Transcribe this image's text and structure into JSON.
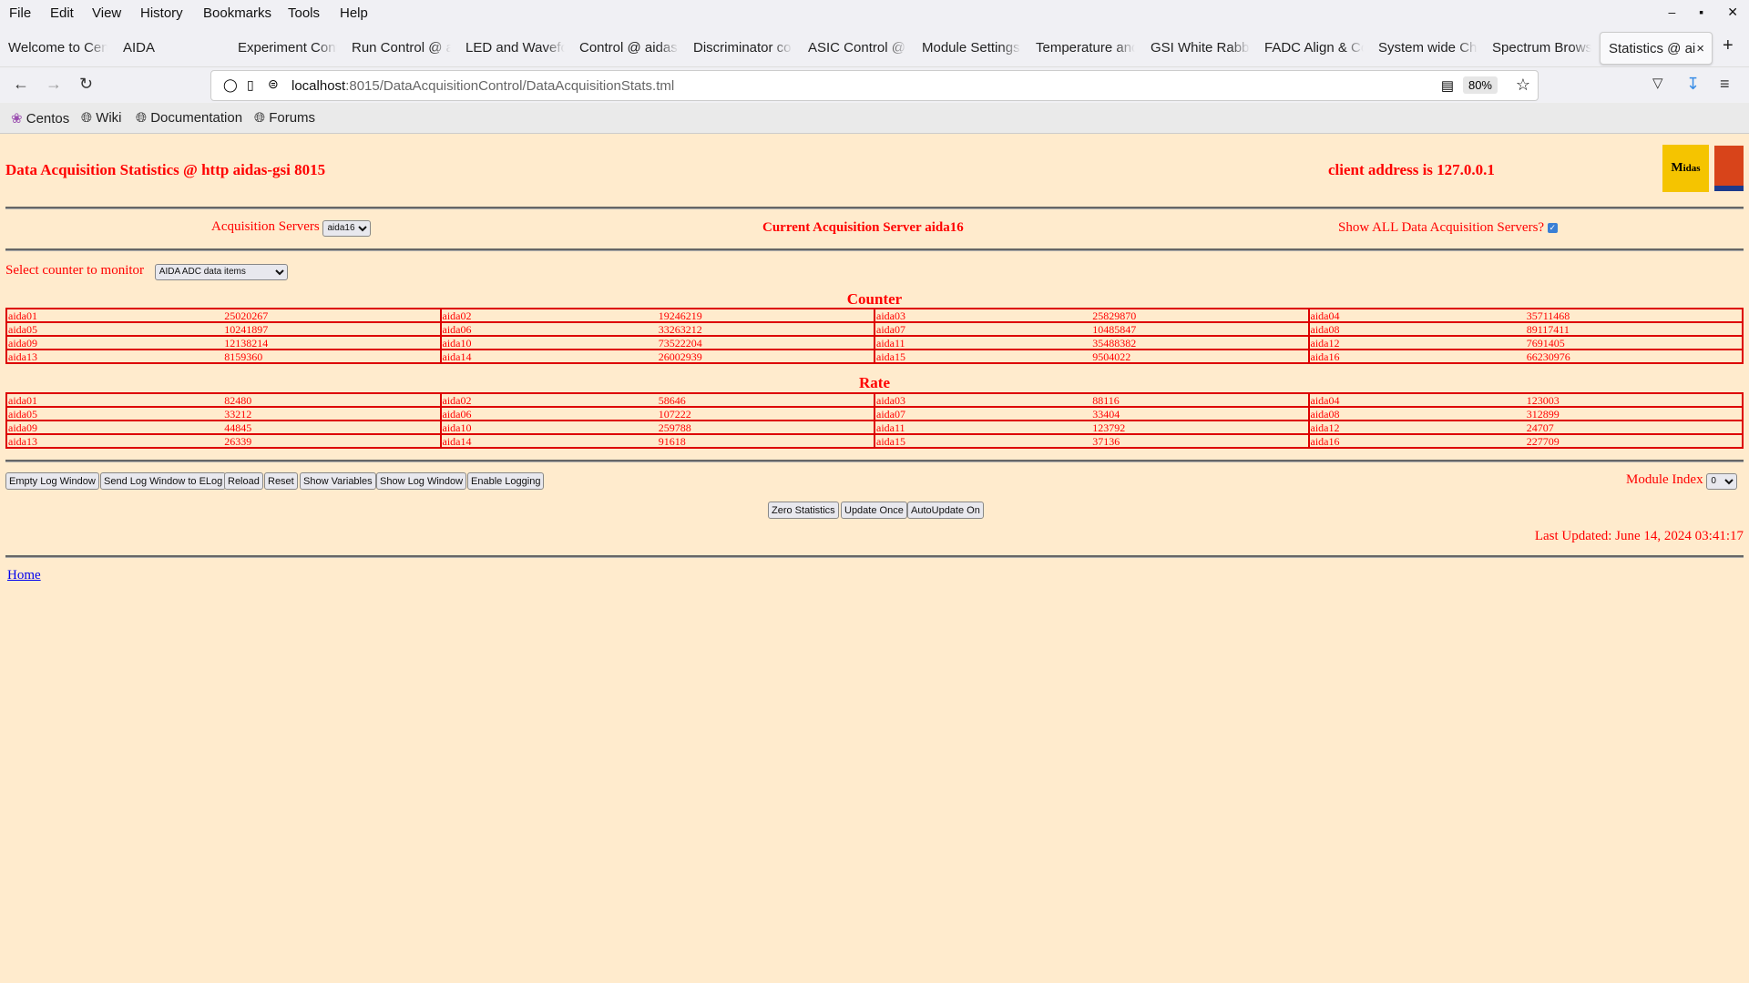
{
  "browser": {
    "menu": [
      "File",
      "Edit",
      "View",
      "History",
      "Bookmarks",
      "Tools",
      "Help"
    ],
    "window_controls": [
      "minimize",
      "maximize",
      "close"
    ],
    "tabs": [
      {
        "label": "Welcome to Cen"
      },
      {
        "label": "AIDA"
      },
      {
        "label": "Experiment Cont"
      },
      {
        "label": "Run Control @ a"
      },
      {
        "label": "LED and Wavefo"
      },
      {
        "label": "Control @ aidas"
      },
      {
        "label": "Discriminator co"
      },
      {
        "label": "ASIC Control @"
      },
      {
        "label": "Module Settings"
      },
      {
        "label": "Temperature and"
      },
      {
        "label": "GSI White Rabbi"
      },
      {
        "label": "FADC Align & Co"
      },
      {
        "label": "System wide Ch"
      },
      {
        "label": "Spectrum Brows"
      },
      {
        "label": "Statistics @ ai",
        "active": true
      }
    ],
    "url_host": "localhost",
    "url_rest": ":8015/DataAcquisitionControl/DataAcquisitionStats.tml",
    "zoom": "80%",
    "bookmarks": [
      "Centos",
      "Wiki",
      "Documentation",
      "Forums"
    ]
  },
  "page": {
    "title": "Data Acquisition Statistics @ http aidas-gsi 8015",
    "client_address": "client address is 127.0.0.1",
    "logo_text": "Midas",
    "acq_servers_label": "Acquisition Servers",
    "acq_servers_value": "aida16",
    "current_server": "Current Acquisition Server aida16",
    "show_all_label": "Show ALL Data Acquisition Servers?",
    "show_all_checked": true,
    "select_counter_label": "Select counter to monitor",
    "select_counter_value": "AIDA ADC data items",
    "counter_heading": "Counter",
    "counter_rows": [
      [
        [
          "aida01",
          "25020267"
        ],
        [
          "aida02",
          "19246219"
        ],
        [
          "aida03",
          "25829870"
        ],
        [
          "aida04",
          "35711468"
        ]
      ],
      [
        [
          "aida05",
          "10241897"
        ],
        [
          "aida06",
          "33263212"
        ],
        [
          "aida07",
          "10485847"
        ],
        [
          "aida08",
          "89117411"
        ]
      ],
      [
        [
          "aida09",
          "12138214"
        ],
        [
          "aida10",
          "73522204"
        ],
        [
          "aida11",
          "35488382"
        ],
        [
          "aida12",
          "7691405"
        ]
      ],
      [
        [
          "aida13",
          "8159360"
        ],
        [
          "aida14",
          "26002939"
        ],
        [
          "aida15",
          "9504022"
        ],
        [
          "aida16",
          "66230976"
        ]
      ]
    ],
    "rate_heading": "Rate",
    "rate_rows": [
      [
        [
          "aida01",
          "82480"
        ],
        [
          "aida02",
          "58646"
        ],
        [
          "aida03",
          "88116"
        ],
        [
          "aida04",
          "123003"
        ]
      ],
      [
        [
          "aida05",
          "33212"
        ],
        [
          "aida06",
          "107222"
        ],
        [
          "aida07",
          "33404"
        ],
        [
          "aida08",
          "312899"
        ]
      ],
      [
        [
          "aida09",
          "44845"
        ],
        [
          "aida10",
          "259788"
        ],
        [
          "aida11",
          "123792"
        ],
        [
          "aida12",
          "24707"
        ]
      ],
      [
        [
          "aida13",
          "26339"
        ],
        [
          "aida14",
          "91618"
        ],
        [
          "aida15",
          "37136"
        ],
        [
          "aida16",
          "227709"
        ]
      ]
    ],
    "buttons": [
      "Empty Log Window",
      "Send Log Window to ELog",
      "Reload",
      "Reset",
      "Show Variables",
      "Show Log Window",
      "Enable Logging"
    ],
    "module_index_label": "Module Index",
    "module_index_value": "0",
    "buttons2": [
      "Zero Statistics",
      "Update Once",
      "AutoUpdate On"
    ],
    "last_updated": "Last Updated: June 14, 2024 03:41:17",
    "home_link": "Home",
    "colors": {
      "text": "#ff0000",
      "background": "#ffebcd",
      "link": "#0000ee"
    }
  }
}
